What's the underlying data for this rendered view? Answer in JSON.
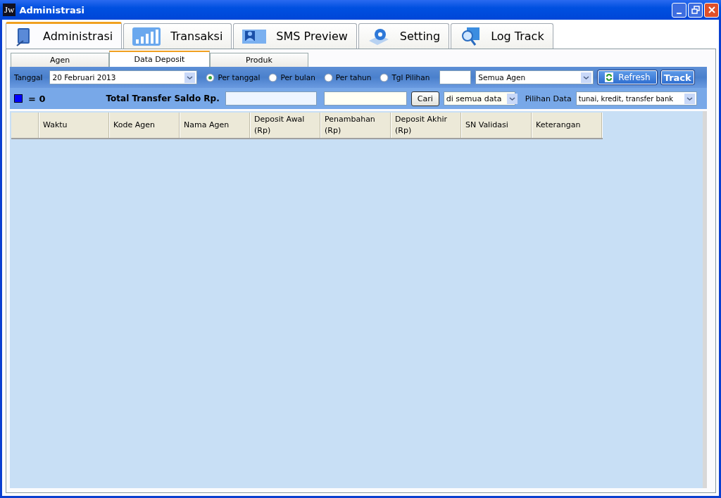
{
  "window": {
    "title": "Administrasi",
    "logo": "Jw"
  },
  "tabs": [
    {
      "label": "Administrasi",
      "selected": true,
      "kind": "book"
    },
    {
      "label": "Transaksi",
      "selected": false,
      "kind": "bars"
    },
    {
      "label": "SMS Preview",
      "selected": false,
      "kind": "person"
    },
    {
      "label": "Setting",
      "selected": false,
      "kind": "gear"
    },
    {
      "label": "Log Track",
      "selected": false,
      "kind": "search"
    }
  ],
  "subtabs": [
    {
      "label": "Agen",
      "selected": false
    },
    {
      "label": "Data Deposit",
      "selected": true
    },
    {
      "label": "Produk",
      "selected": false
    }
  ],
  "filter": {
    "date_label": "Tanggal",
    "date_value": "20  Februari  2013",
    "modes": [
      {
        "label": "Per tanggal",
        "selected": true
      },
      {
        "label": "Per bulan",
        "selected": false
      },
      {
        "label": "Per tahun",
        "selected": false
      },
      {
        "label": "Tgl Pilihan",
        "selected": false
      }
    ],
    "agent_value": "Semua Agen",
    "refresh": "Refresh",
    "track": "Track"
  },
  "summary": {
    "legend": {
      "color": "#0000ff",
      "text": "= 0"
    },
    "total_label": "Total Transfer Saldo Rp.",
    "search_button": "Cari",
    "scope_value": "di semua data",
    "data_label": "Pilihan Data",
    "data_value": "tunai, kredit, transfer bank"
  },
  "table": {
    "columns": [
      "Waktu",
      "Kode Agen",
      "Nama Agen",
      "Deposit Awal\n(Rp)",
      "Penambahan\n(Rp)",
      "Deposit Akhir\n(Rp)",
      "SN Validasi",
      "Keterangan"
    ]
  }
}
